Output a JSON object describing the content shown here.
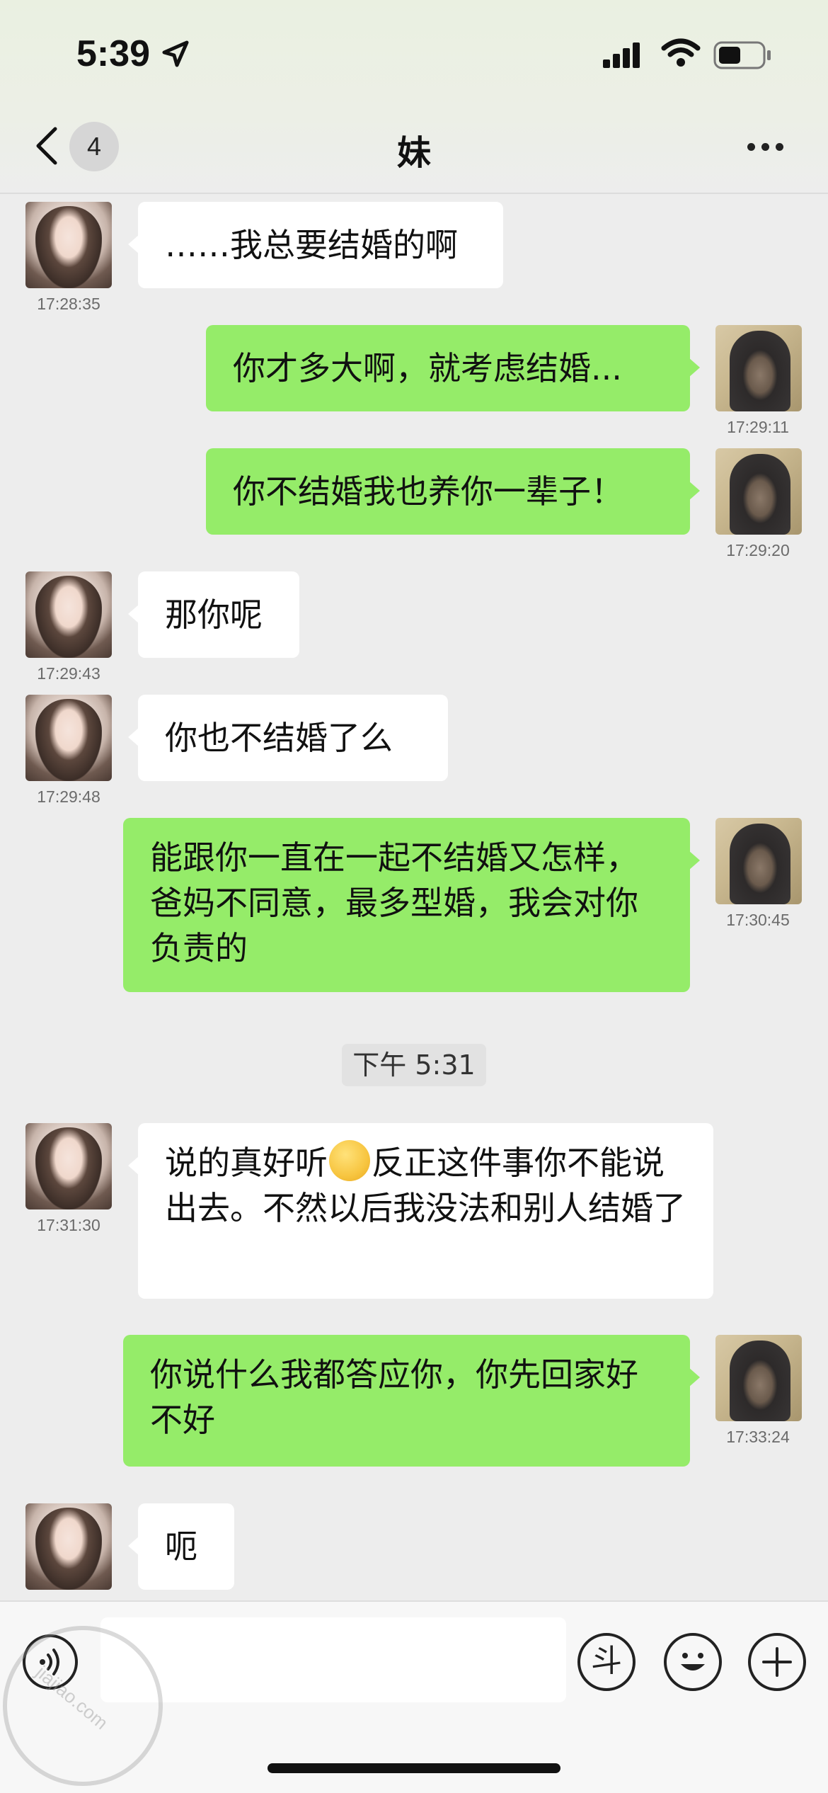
{
  "status_bar": {
    "time": "5:39"
  },
  "nav": {
    "unread_count": "4",
    "title": "妹"
  },
  "messages": [
    {
      "side": "left",
      "text": "……我总要结婚的啊",
      "time": "17:28:35"
    },
    {
      "side": "right",
      "text": "你才多大啊，就考虑结婚...",
      "time": "17:29:11"
    },
    {
      "side": "right",
      "text": "你不结婚我也养你一辈子！",
      "time": "17:29:20"
    },
    {
      "side": "left",
      "text": "那你呢",
      "time": "17:29:43"
    },
    {
      "side": "left",
      "text": "你也不结婚了么",
      "time": "17:29:48"
    },
    {
      "side": "right",
      "text": "能跟你一直在一起不结婚又怎样，爸妈不同意，最多型婚，我会对你负责的",
      "time": "17:30:45"
    },
    {
      "side": "left",
      "text_before": "说的真好听",
      "text_after": "反正这件事你不能说出去。不然以后我没法和别人结婚了",
      "time": "17:31:30"
    },
    {
      "side": "right",
      "text": "你说什么我都答应你，你先回家好不好",
      "time": "17:33:24"
    },
    {
      "side": "left",
      "text": "呃",
      "time": ""
    }
  ],
  "divider": {
    "text": "下午 5:31"
  },
  "input_bar": {
    "input_value": "",
    "sticker_btn": "斗"
  },
  "watermark": {
    "text": "jiajiao.com"
  },
  "colors": {
    "bubble_right": "#95ec69",
    "bubble_left": "#ffffff",
    "background": "#ededed"
  },
  "icons": [
    "back-icon",
    "more-icon",
    "voice-icon",
    "sticker-icon",
    "emoji-icon",
    "plus-icon"
  ]
}
